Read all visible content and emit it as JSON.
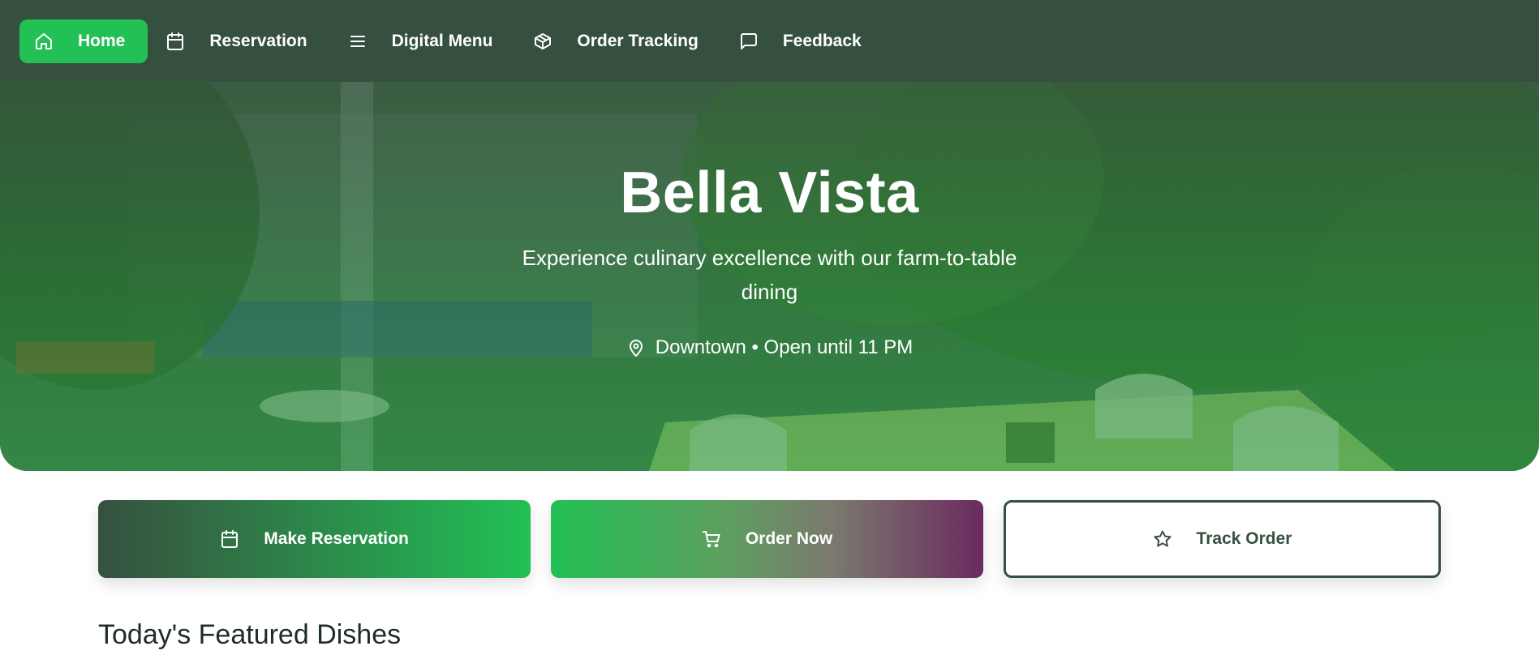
{
  "nav": {
    "items": [
      {
        "label": "Home",
        "icon": "home-icon",
        "active": true
      },
      {
        "label": "Reservation",
        "icon": "calendar-icon",
        "active": false
      },
      {
        "label": "Digital Menu",
        "icon": "menu-lines-icon",
        "active": false
      },
      {
        "label": "Order Tracking",
        "icon": "package-icon",
        "active": false
      },
      {
        "label": "Feedback",
        "icon": "chat-icon",
        "active": false
      }
    ]
  },
  "hero": {
    "title": "Bella Vista",
    "subtitle": "Experience culinary excellence with our farm-to-table dining",
    "location": "Downtown • Open until 11 PM",
    "location_icon": "map-pin-icon"
  },
  "actions": [
    {
      "label": "Make Reservation",
      "icon": "calendar-icon"
    },
    {
      "label": "Order Now",
      "icon": "cart-icon"
    },
    {
      "label": "Track Order",
      "icon": "star-icon"
    }
  ],
  "featured": {
    "heading": "Today's Featured Dishes"
  },
  "colors": {
    "nav_bg": "#36503f",
    "accent": "#22c055",
    "order_end": "#6b2a5e"
  }
}
